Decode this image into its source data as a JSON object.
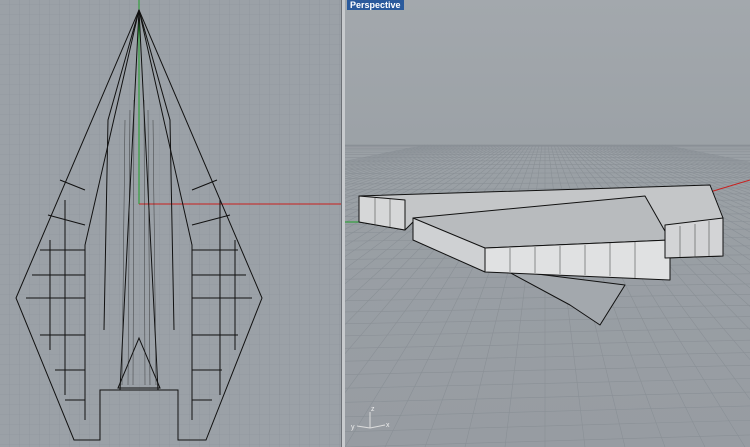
{
  "viewports": {
    "top": {
      "title": ""
    },
    "perspective": {
      "title": "Perspective",
      "axes": {
        "x": "x",
        "y": "y",
        "z": "z"
      }
    }
  },
  "colors": {
    "x_axis": "#c8201e",
    "y_axis": "#1fa02a",
    "title_bg": "#2a5a9c"
  }
}
